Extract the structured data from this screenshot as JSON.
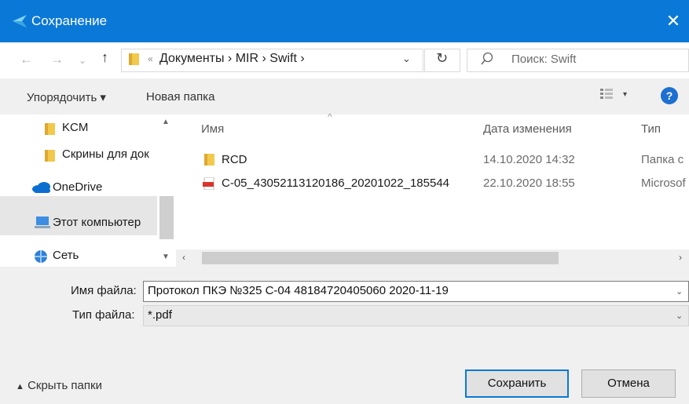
{
  "window": {
    "title": "Сохранение"
  },
  "address": {
    "breadcrumb": "Документы  ›  MIR  ›  Swift  ›",
    "more": "«",
    "search_placeholder": "Поиск: Swift"
  },
  "toolbar": {
    "organize": "Упорядочить ▾",
    "new_folder": "Новая папка"
  },
  "nav_pane": {
    "items": [
      {
        "label": "KCM",
        "icon": "folder-icon"
      },
      {
        "label": "Скрины для док",
        "icon": "folder-icon"
      },
      {
        "label": "OneDrive",
        "icon": "cloud-icon"
      },
      {
        "label": "Этот компьютер",
        "icon": "computer-icon",
        "selected": true
      },
      {
        "label": "Сеть",
        "icon": "network-icon"
      }
    ]
  },
  "file_list": {
    "columns": [
      "Имя",
      "Дата изменения",
      "Тип"
    ],
    "rows": [
      {
        "name": "RCD",
        "date": "14.10.2020 14:32",
        "type": "Папка с",
        "icon": "folder-icon"
      },
      {
        "name": "C-05_43052113120186_20201022_185544",
        "date": "22.10.2020 18:55",
        "type": "Microsof",
        "icon": "pdf-icon"
      }
    ]
  },
  "form": {
    "file_name_label": "Имя файла:",
    "file_name_value": "Протокол ПКЭ №325 С-04 48184720405060 2020-11-19",
    "file_type_label": "Тип файла:",
    "file_type_value": "*.pdf"
  },
  "footer": {
    "hide_folders": "Скрыть папки",
    "save": "Сохранить",
    "cancel": "Отмена"
  },
  "colors": {
    "accent": "#0a78d7",
    "folder": "#f2c94c",
    "pdf": "#d9342b"
  }
}
